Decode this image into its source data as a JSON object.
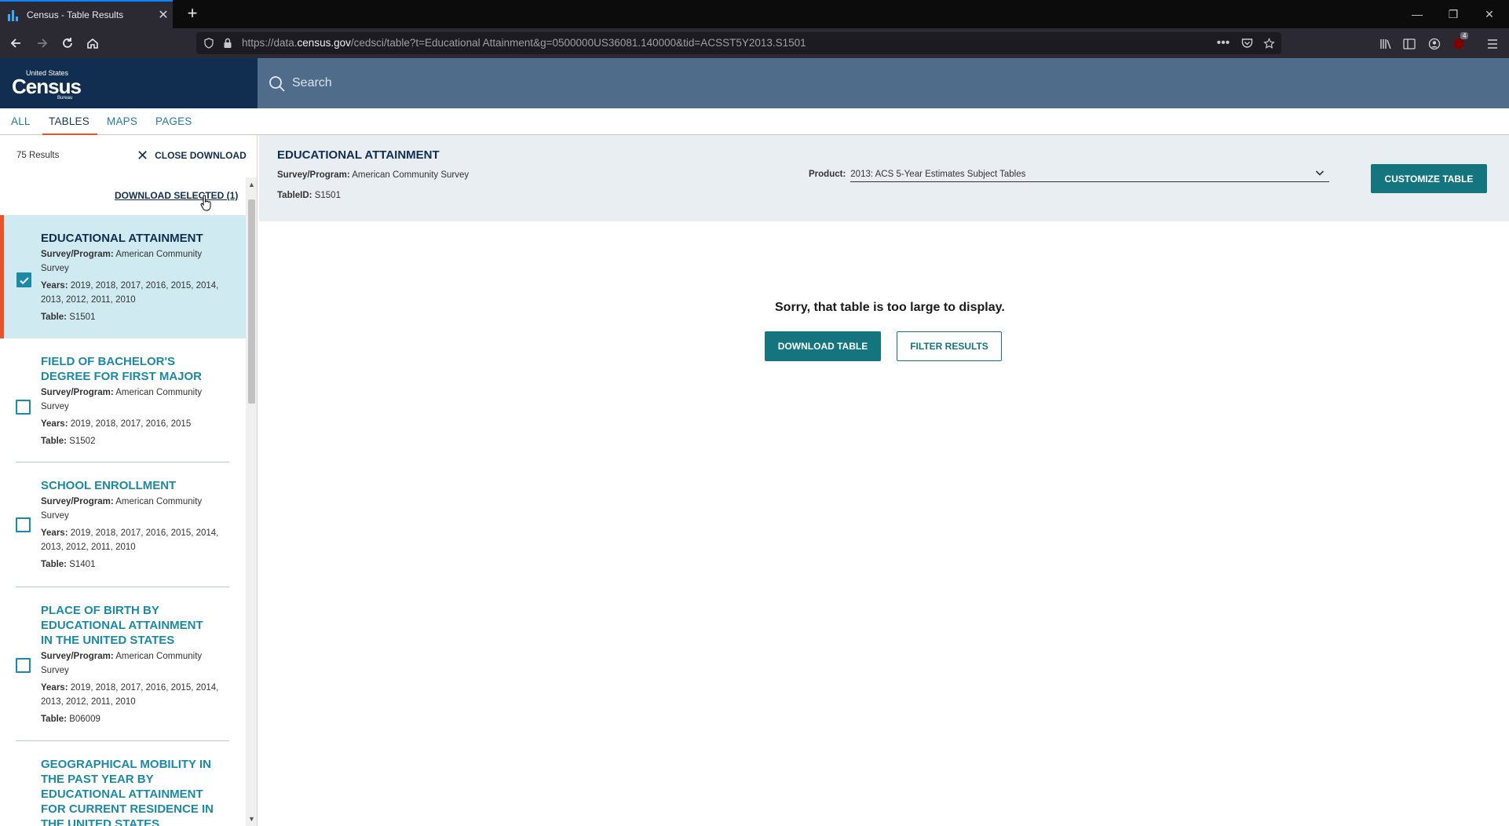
{
  "browser": {
    "tab_title": "Census - Table Results",
    "url_prefix": "https://data.",
    "url_host": "census.gov",
    "url_path": "/cedsci/table?t=Educational Attainment&g=0500000US36081.140000&tid=ACSST5Y2013.S1501",
    "extension_badge": "4",
    "window_controls": [
      "—",
      "❐",
      "✕"
    ]
  },
  "header": {
    "logo_line1": "United States",
    "logo_line2": "Census",
    "logo_line3": "Bureau",
    "search_placeholder": "Search"
  },
  "category_tabs": [
    {
      "label": "ALL",
      "active": false
    },
    {
      "label": "TABLES",
      "active": true
    },
    {
      "label": "MAPS",
      "active": false
    },
    {
      "label": "PAGES",
      "active": false
    }
  ],
  "left_panel": {
    "results_count": "75 Results",
    "close_download_label": "CLOSE DOWNLOAD",
    "download_selected_label": "DOWNLOAD SELECTED (1)",
    "survey_label": "Survey/Program:",
    "years_label": "Years:",
    "table_label": "Table:",
    "items": [
      {
        "title": "EDUCATIONAL ATTAINMENT",
        "survey": "American Community Survey",
        "years": "2019, 2018, 2017, 2016, 2015, 2014, 2013, 2012, 2011, 2010",
        "table": "S1501",
        "checked": true
      },
      {
        "title": "FIELD OF BACHELOR'S DEGREE FOR FIRST MAJOR",
        "survey": "American Community Survey",
        "years": "2019, 2018, 2017, 2016, 2015",
        "table": "S1502",
        "checked": false
      },
      {
        "title": "SCHOOL ENROLLMENT",
        "survey": "American Community Survey",
        "years": "2019, 2018, 2017, 2016, 2015, 2014, 2013, 2012, 2011, 2010",
        "table": "S1401",
        "checked": false
      },
      {
        "title": "PLACE OF BIRTH BY EDUCATIONAL ATTAINMENT IN THE UNITED STATES",
        "survey": "American Community Survey",
        "years": "2019, 2018, 2017, 2016, 2015, 2014, 2013, 2012, 2011, 2010",
        "table": "B06009",
        "checked": false
      },
      {
        "title": "GEOGRAPHICAL MOBILITY IN THE PAST YEAR BY EDUCATIONAL ATTAINMENT FOR CURRENT RESIDENCE IN THE UNITED STATES",
        "survey": "",
        "years": "",
        "table": "",
        "checked": false
      }
    ]
  },
  "table_view": {
    "title": "EDUCATIONAL ATTAINMENT",
    "survey_label": "Survey/Program:",
    "survey_value": "American Community Survey",
    "tableid_label": "TableID:",
    "tableid_value": "S1501",
    "product_label": "Product:",
    "product_value": "2013: ACS 5-Year Estimates Subject Tables",
    "customize_label": "CUSTOMIZE TABLE",
    "message": "Sorry, that table is too large to display.",
    "download_table_label": "DOWNLOAD TABLE",
    "filter_results_label": "FILTER RESULTS"
  },
  "colors": {
    "census_navy": "#112e51",
    "search_bar": "#4f6c8b",
    "teal": "#15757f",
    "link_teal": "#1a8aa6",
    "accent_orange": "#e8542a",
    "selected_bg": "#d0eaf1",
    "header_bg": "#e8eef2"
  }
}
